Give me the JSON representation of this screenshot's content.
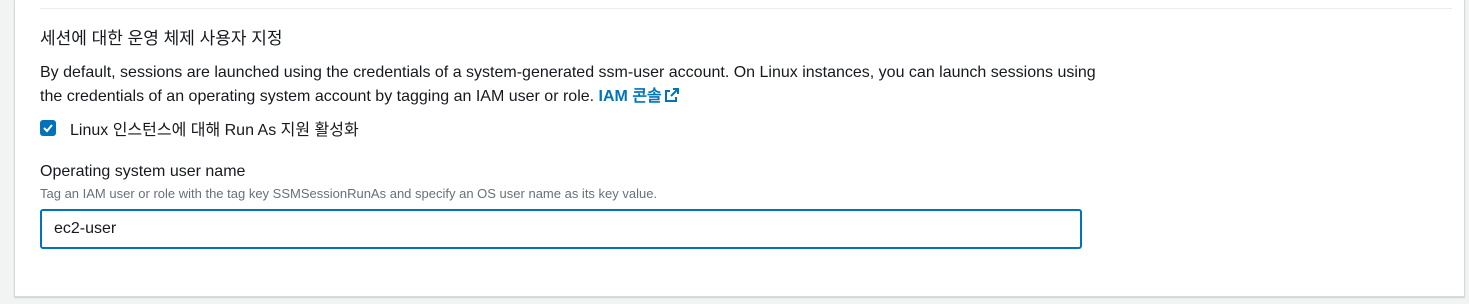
{
  "section": {
    "title": "세션에 대한 운영 체제 사용자 지정",
    "description": "By default, sessions are launched using the credentials of a system-generated ssm-user account. On Linux instances, you can launch sessions using the credentials of an operating system account by tagging an IAM user or role.",
    "link_label": "IAM 콘솔",
    "link_icon": "external-link-icon"
  },
  "run_as": {
    "checkbox_label": "Linux 인스턴스에 대해 Run As 지원 활성화",
    "checked": true
  },
  "os_user": {
    "label": "Operating system user name",
    "description": "Tag an IAM user or role with the tag key SSMSessionRunAs and specify an OS user name as its key value.",
    "value": "ec2-user"
  },
  "colors": {
    "accent": "#0073bb",
    "text": "#16191f",
    "muted": "#687078",
    "background": "#f2f3f3"
  }
}
